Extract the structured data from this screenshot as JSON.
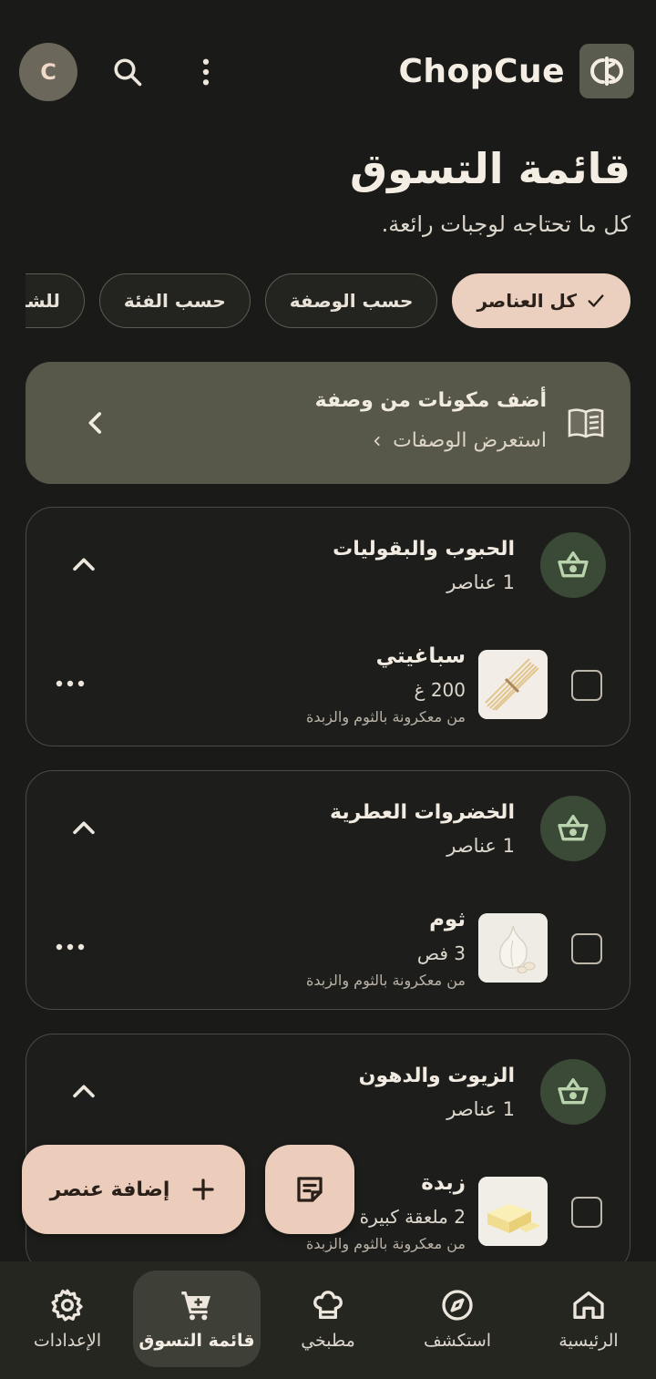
{
  "app": {
    "name": "ChopCue",
    "avatar_initial": "C"
  },
  "header": {
    "title": "قائمة التسوق",
    "subtitle": "كل ما تحتاجه لوجبات رائعة."
  },
  "filters": [
    {
      "label": "كل العناصر",
      "active": true
    },
    {
      "label": "حسب الوصفة",
      "active": false
    },
    {
      "label": "حسب الفئة",
      "active": false
    },
    {
      "label": "للشراء",
      "active": false
    }
  ],
  "recipe_banner": {
    "title": "أضف مكونات من وصفة",
    "link": "استعرض الوصفات"
  },
  "categories": [
    {
      "name": "الحبوب والبقوليات",
      "count": "1 عناصر",
      "item": {
        "name": "سباغيتي",
        "qty": "200 غ",
        "source": "من معكرونة بالثوم والزبدة"
      }
    },
    {
      "name": "الخضروات العطرية",
      "count": "1 عناصر",
      "item": {
        "name": "ثوم",
        "qty": "3 فص",
        "source": "من معكرونة بالثوم والزبدة"
      }
    },
    {
      "name": "الزيوت والدهون",
      "count": "1 عناصر",
      "item": {
        "name": "زبدة",
        "qty": "2 ملعقة كبيرة",
        "source": "من معكرونة بالثوم والزبدة"
      }
    }
  ],
  "fab": {
    "add_label": "إضافة عنصر"
  },
  "nav": [
    {
      "label": "الرئيسية",
      "icon": "home-icon",
      "active": false
    },
    {
      "label": "استكشف",
      "icon": "compass-icon",
      "active": false
    },
    {
      "label": "مطبخي",
      "icon": "chef-hat-icon",
      "active": false
    },
    {
      "label": "قائمة التسوق",
      "icon": "cart-icon",
      "active": true
    },
    {
      "label": "الإعدادات",
      "icon": "gear-icon",
      "active": false
    }
  ],
  "colors": {
    "background": "#1a1b18",
    "accent": "#ecd0bf",
    "icon_green": "#3a4a36"
  }
}
